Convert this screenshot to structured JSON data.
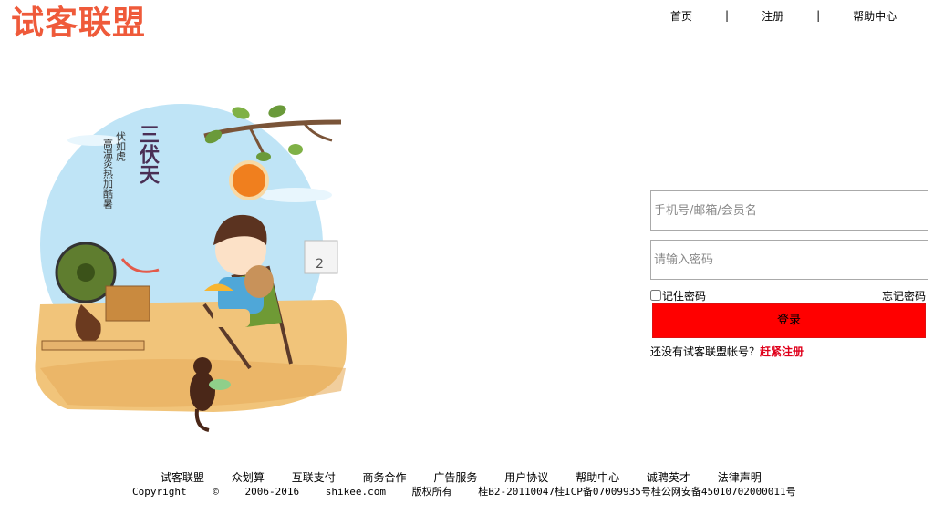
{
  "brand": {
    "name": "试客联盟",
    "color": "#ef5a3a"
  },
  "topnav": [
    {
      "label": "首页"
    },
    {
      "label": "注册"
    },
    {
      "label": "帮助中心"
    }
  ],
  "topnav_separator": "|",
  "hero": {
    "title": "三伏天",
    "subtitle1": "伏如虎",
    "subtitle2": "高温炎热加酷暑",
    "calendar_digit": "2"
  },
  "login": {
    "username_placeholder": "手机号/邮箱/会员名",
    "password_placeholder": "请输入密码",
    "remember_label": "记住密码",
    "forgot_label": "忘记密码",
    "submit_label": "登录",
    "register_prompt": "还没有试客联盟帐号？",
    "register_link": "赶紧注册",
    "button_color": "#ff0000"
  },
  "footer": {
    "links": [
      "试客联盟",
      "众划算",
      "互联支付",
      "商务合作",
      "广告服务",
      "用户协议",
      "帮助中心",
      "诚聘英才",
      "法律声明"
    ],
    "copyright": [
      "Copyright",
      "©",
      "2006-2016",
      "shikee.com",
      "版权所有",
      "桂B2-20110047桂ICP备07009935号桂公网安备45010702000011号"
    ]
  }
}
